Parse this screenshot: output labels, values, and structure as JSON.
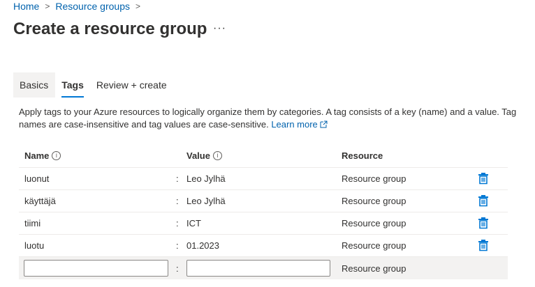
{
  "breadcrumb": {
    "home": "Home",
    "resource_groups": "Resource groups",
    "separator": ">"
  },
  "page": {
    "title": "Create a resource group",
    "more": "···"
  },
  "tabs": [
    {
      "label": "Basics",
      "active": false
    },
    {
      "label": "Tags",
      "active": true
    },
    {
      "label": "Review + create",
      "active": false
    }
  ],
  "description": {
    "text": "Apply tags to your Azure resources to logically organize them by categories. A tag consists of a key (name) and a value. Tag names are case-insensitive and tag values are case-sensitive.",
    "learn_more": "Learn more"
  },
  "table": {
    "headers": {
      "name": "Name",
      "value": "Value",
      "resource": "Resource",
      "info_icon": "i"
    },
    "separator": ":",
    "rows": [
      {
        "name": "luonut",
        "value": "Leo Jylhä",
        "resource": "Resource group"
      },
      {
        "name": "käyttäjä",
        "value": "Leo Jylhä",
        "resource": "Resource group"
      },
      {
        "name": "tiimi",
        "value": "ICT",
        "resource": "Resource group"
      },
      {
        "name": "luotu",
        "value": "01.2023",
        "resource": "Resource group"
      }
    ],
    "new_row": {
      "name_value": "",
      "value_value": "",
      "resource": "Resource group"
    }
  },
  "icons": {
    "delete": "trash-icon",
    "external": "external-link-icon",
    "info": "info-icon",
    "chevron": "chevron-right-icon"
  },
  "colors": {
    "link": "#0062ad",
    "accent": "#0078d4",
    "delete_icon": "#0078d4"
  }
}
